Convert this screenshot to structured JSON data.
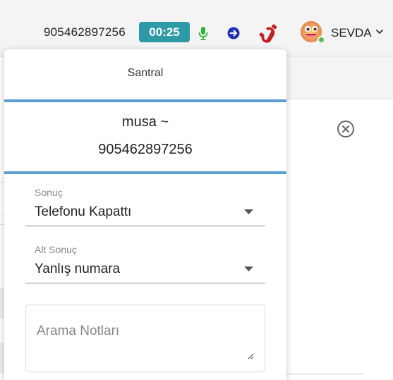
{
  "topbar": {
    "phone_number": "905462897256",
    "call_timer": "00:25",
    "user_name": "SEVDA",
    "icons": [
      "microphone-icon",
      "forward-arrow-icon",
      "hangup-phone-icon",
      "avatar-emoji",
      "chevron-down-icon"
    ],
    "colors": {
      "timer_bg": "#2e9aa6",
      "mic": "#2fb53a",
      "forward": "#1f2fb8",
      "hangup": "#c21f1f",
      "status_online": "#5cb85c"
    }
  },
  "panel": {
    "title": "Santral",
    "caller": {
      "name": "musa ~",
      "number": "905462897256"
    },
    "accent_color": "#5b9fd0",
    "result": {
      "label": "Sonuç",
      "value": "Telefonu Kapattı"
    },
    "sub_result": {
      "label": "Alt Sonuç",
      "value": "Yanlış numara"
    },
    "notes": {
      "placeholder": "Arama Notları",
      "value": ""
    }
  }
}
